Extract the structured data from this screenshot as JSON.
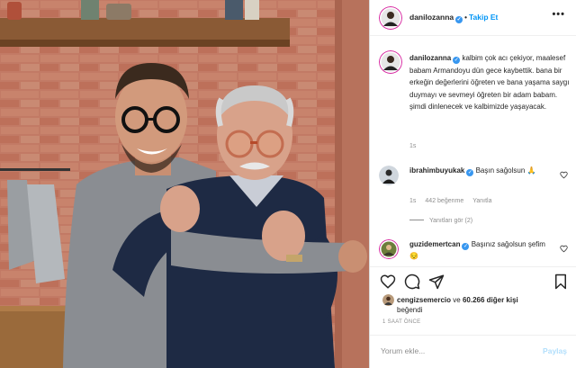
{
  "post": {
    "owner": "danilozanna",
    "follow_label": "Takip Et",
    "separator": "•",
    "more_icon": "•••"
  },
  "caption": {
    "username": "danilozanna",
    "text": "kalbim çok acı çekiyor, maalesef babam Armandoyu dün gece kaybettik. bana bir erkeğin değerlerini öğreten ve bana yaşama saygı duymayı ve sevmeyi öğreten bir adam babam. şimdi dinlenecek ve kalbimizde yaşayacak.",
    "time": "1s"
  },
  "comments": [
    {
      "username": "ibrahimbuyukak",
      "text": "Başın sağolsun 🙏",
      "time": "1s",
      "likes": "442 beğenme",
      "reply_label": "Yanıtla",
      "view_replies": "Yanıtları gör (2)"
    },
    {
      "username": "guzidemertcan",
      "text": "Başınız sağolsun şefim 😔"
    }
  ],
  "likes": {
    "username": "cengizsemercio",
    "joiner": "ve",
    "others": "60.266 diğer kişi",
    "suffix": "beğendi"
  },
  "timestamp": "1 SAAT ÖNCE",
  "comment_box": {
    "placeholder": "Yorum ekle...",
    "post_label": "Paylaş"
  },
  "colors": {
    "accent": "#0095f6",
    "verified": "#3897f0",
    "muted": "#8e8e8e",
    "brick": "#b9664e"
  }
}
